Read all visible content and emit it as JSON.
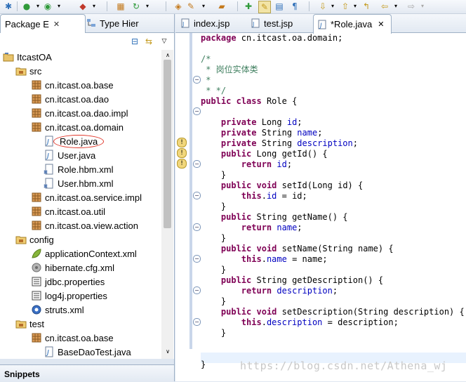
{
  "left_panel": {
    "tabs": [
      {
        "label": "Package E",
        "close": "✕"
      },
      {
        "label": "Type Hier"
      }
    ],
    "tree": [
      {
        "label": "ItcastOA",
        "icon": "project-icon",
        "indent": 0
      },
      {
        "label": "src",
        "icon": "source-folder-icon",
        "indent": 1
      },
      {
        "label": "cn.itcast.oa.base",
        "icon": "package-icon",
        "indent": 2
      },
      {
        "label": "cn.itcast.oa.dao",
        "icon": "package-icon",
        "indent": 2
      },
      {
        "label": "cn.itcast.oa.dao.impl",
        "icon": "package-icon",
        "indent": 2
      },
      {
        "label": "cn.itcast.oa.domain",
        "icon": "package-icon",
        "indent": 2
      },
      {
        "label": "Role.java",
        "icon": "java-file-icon",
        "indent": 3,
        "highlight": true
      },
      {
        "label": "User.java",
        "icon": "java-file-icon",
        "indent": 3
      },
      {
        "label": "Role.hbm.xml",
        "icon": "xml-file-icon",
        "indent": 3
      },
      {
        "label": "User.hbm.xml",
        "icon": "xml-file-icon",
        "indent": 3
      },
      {
        "label": "cn.itcast.oa.service.impl",
        "icon": "package-icon",
        "indent": 2
      },
      {
        "label": "cn.itcast.oa.util",
        "icon": "package-icon",
        "indent": 2
      },
      {
        "label": "cn.itcast.oa.view.action",
        "icon": "package-icon",
        "indent": 2
      },
      {
        "label": "config",
        "icon": "source-folder-icon",
        "indent": 1
      },
      {
        "label": "applicationContext.xml",
        "icon": "spring-leaf-icon",
        "indent": 2
      },
      {
        "label": "hibernate.cfg.xml",
        "icon": "hibernate-icon",
        "indent": 2
      },
      {
        "label": "jdbc.properties",
        "icon": "properties-file-icon",
        "indent": 2
      },
      {
        "label": "log4j.properties",
        "icon": "properties-file-icon",
        "indent": 2
      },
      {
        "label": "struts.xml",
        "icon": "struts-gear-icon",
        "indent": 2
      },
      {
        "label": "test",
        "icon": "source-folder-icon",
        "indent": 1
      },
      {
        "label": "cn.itcast.oa.base",
        "icon": "package-icon",
        "indent": 2
      },
      {
        "label": "BaseDaoTest.java",
        "icon": "java-file-icon",
        "indent": 3
      }
    ],
    "snippets_label": "Snippets"
  },
  "editor": {
    "tabs": [
      {
        "label": "index.jsp"
      },
      {
        "label": "test.jsp"
      },
      {
        "label": "*Role.java",
        "close": "✕"
      }
    ],
    "code_lines": [
      [
        {
          "t": "package",
          "c": "kw"
        },
        {
          "t": " cn.itcast.oa.domain;"
        }
      ],
      [],
      [
        {
          "t": "/*",
          "c": "cm"
        }
      ],
      [
        {
          "t": " * 岗位实体类",
          "c": "cm"
        }
      ],
      [
        {
          "t": " *",
          "c": "cm"
        }
      ],
      [
        {
          "t": " * */",
          "c": "cm"
        }
      ],
      [
        {
          "t": "public",
          "c": "kw"
        },
        {
          "t": " "
        },
        {
          "t": "class",
          "c": "kw"
        },
        {
          "t": " Role {"
        }
      ],
      [],
      [
        {
          "t": "    "
        },
        {
          "t": "private",
          "c": "kw"
        },
        {
          "t": " Long "
        },
        {
          "t": "id",
          "c": "fld"
        },
        {
          "t": ";"
        }
      ],
      [
        {
          "t": "    "
        },
        {
          "t": "private",
          "c": "kw"
        },
        {
          "t": " String "
        },
        {
          "t": "name",
          "c": "fld"
        },
        {
          "t": ";"
        }
      ],
      [
        {
          "t": "    "
        },
        {
          "t": "private",
          "c": "kw"
        },
        {
          "t": " String "
        },
        {
          "t": "description",
          "c": "fld"
        },
        {
          "t": ";"
        }
      ],
      [
        {
          "t": "    "
        },
        {
          "t": "public",
          "c": "kw"
        },
        {
          "t": " Long getId() {"
        }
      ],
      [
        {
          "t": "        "
        },
        {
          "t": "return",
          "c": "kw"
        },
        {
          "t": " "
        },
        {
          "t": "id",
          "c": "fld"
        },
        {
          "t": ";"
        }
      ],
      [
        {
          "t": "    }"
        }
      ],
      [
        {
          "t": "    "
        },
        {
          "t": "public",
          "c": "kw"
        },
        {
          "t": " "
        },
        {
          "t": "void",
          "c": "kw"
        },
        {
          "t": " setId(Long id) {"
        }
      ],
      [
        {
          "t": "        "
        },
        {
          "t": "this",
          "c": "kw"
        },
        {
          "t": "."
        },
        {
          "t": "id",
          "c": "fld"
        },
        {
          "t": " = id;"
        }
      ],
      [
        {
          "t": "    }"
        }
      ],
      [
        {
          "t": "    "
        },
        {
          "t": "public",
          "c": "kw"
        },
        {
          "t": " String getName() {"
        }
      ],
      [
        {
          "t": "        "
        },
        {
          "t": "return",
          "c": "kw"
        },
        {
          "t": " "
        },
        {
          "t": "name",
          "c": "fld"
        },
        {
          "t": ";"
        }
      ],
      [
        {
          "t": "    }"
        }
      ],
      [
        {
          "t": "    "
        },
        {
          "t": "public",
          "c": "kw"
        },
        {
          "t": " "
        },
        {
          "t": "void",
          "c": "kw"
        },
        {
          "t": " setName(String name) {"
        }
      ],
      [
        {
          "t": "        "
        },
        {
          "t": "this",
          "c": "kw"
        },
        {
          "t": "."
        },
        {
          "t": "name",
          "c": "fld"
        },
        {
          "t": " = name;"
        }
      ],
      [
        {
          "t": "    }"
        }
      ],
      [
        {
          "t": "    "
        },
        {
          "t": "public",
          "c": "kw"
        },
        {
          "t": " String getDescription() {"
        }
      ],
      [
        {
          "t": "        "
        },
        {
          "t": "return",
          "c": "kw"
        },
        {
          "t": " "
        },
        {
          "t": "description",
          "c": "fld"
        },
        {
          "t": ";"
        }
      ],
      [
        {
          "t": "    }"
        }
      ],
      [
        {
          "t": "    "
        },
        {
          "t": "public",
          "c": "kw"
        },
        {
          "t": " "
        },
        {
          "t": "void",
          "c": "kw"
        },
        {
          "t": " setDescription(String description) {"
        }
      ],
      [
        {
          "t": "        "
        },
        {
          "t": "this",
          "c": "kw"
        },
        {
          "t": "."
        },
        {
          "t": "description",
          "c": "fld"
        },
        {
          "t": " = description;"
        }
      ],
      [
        {
          "t": "    }"
        }
      ],
      [],
      [],
      [
        {
          "t": "}"
        }
      ]
    ],
    "watermark": "https://blog.csdn.net/Athena_wj"
  },
  "colors": {
    "keyword": "#7f0055",
    "field": "#0000c0",
    "comment": "#3f7f5f",
    "highlight_ring": "#e0362a"
  }
}
